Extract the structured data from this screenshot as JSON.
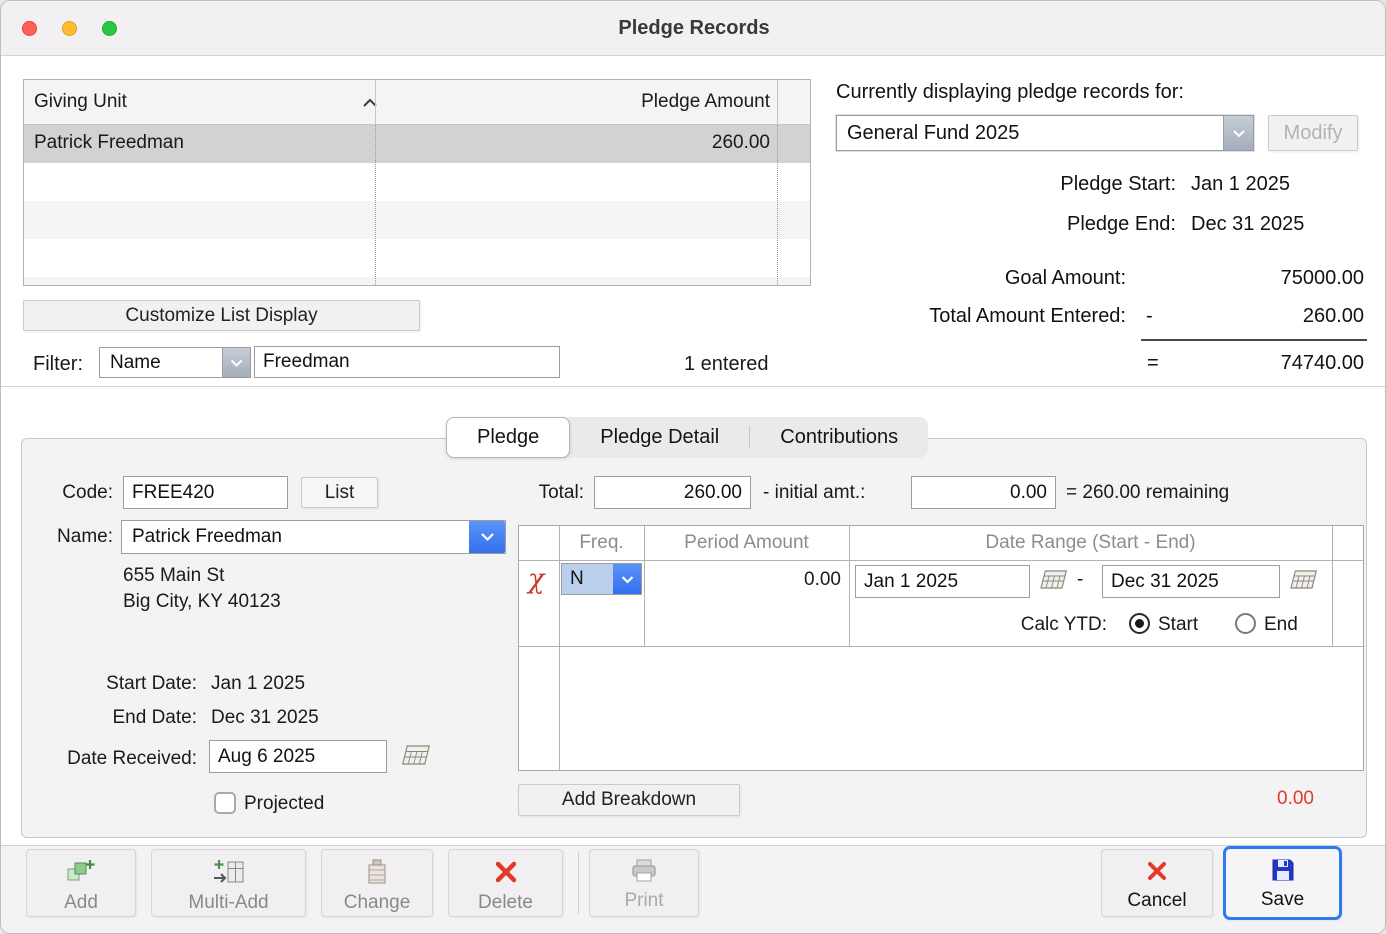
{
  "window": {
    "title": "Pledge Records"
  },
  "colors": {
    "accent_blue": "#3f7df6",
    "focus_ring_blue": "#2d7bee",
    "alert_red": "#e23a2a",
    "selected_row_gray": "#d3d1d2",
    "freq_highlight_blue": "#b9cfec"
  },
  "icons": {
    "sort_ascending": "chevron-up",
    "dropdown": "chevron-down",
    "delete_row_flag": "χ",
    "date_picker": "calendar",
    "add": "green-plus-squares",
    "multi_add": "grid-arrow-plus",
    "change": "card-file",
    "delete": "red-x",
    "print": "printer",
    "cancel": "red-x",
    "save": "floppy-disk"
  },
  "giving_list": {
    "col_giving_unit": "Giving Unit",
    "col_pledge_amount": "Pledge Amount",
    "rows": [
      {
        "name": "Patrick Freedman",
        "amount": "260.00"
      }
    ],
    "customize_button": "Customize List Display",
    "filter_label": "Filter:",
    "filter_field": "Name",
    "filter_value": "Freedman",
    "entered_count": "1 entered"
  },
  "fund_panel": {
    "heading": "Currently displaying pledge records for:",
    "fund_name": "General Fund 2025",
    "modify_button": "Modify",
    "pledge_start_label": "Pledge Start:",
    "pledge_start_value": "Jan 1 2025",
    "pledge_end_label": "Pledge End:",
    "pledge_end_value": "Dec 31 2025",
    "goal_label": "Goal Amount:",
    "goal_value": "75000.00",
    "entered_label": "Total Amount Entered:",
    "minus_sign": "-",
    "entered_value": "260.00",
    "equals_sign": "=",
    "remaining_value": "74740.00"
  },
  "detail": {
    "tabs": [
      {
        "label": "Pledge"
      },
      {
        "label": "Pledge Detail"
      },
      {
        "label": "Contributions"
      }
    ],
    "code_label": "Code:",
    "code_value": "FREE420",
    "list_button": "List",
    "name_label": "Name:",
    "name_value": "Patrick Freedman",
    "address_line1": "655 Main St",
    "address_line2": "Big City, KY 40123",
    "start_date_label": "Start Date:",
    "start_date_value": "Jan 1 2025",
    "end_date_label": "End Date:",
    "end_date_value": "Dec 31 2025",
    "date_received_label": "Date Received:",
    "date_received_value": "Aug 6 2025",
    "projected_label": "Projected",
    "total_label": "Total:",
    "total_value": "260.00",
    "initial_label": "- initial amt.:",
    "initial_value": "0.00",
    "remaining_text": "= 260.00 remaining",
    "breakdown": {
      "col_freq": "Freq.",
      "col_period_amount": "Period Amount",
      "col_date_range": "Date Range (Start - End)",
      "row_flag": "χ",
      "row_freq": "N",
      "row_amount": "0.00",
      "row_start": "Jan 1 2025",
      "row_dash": "-",
      "row_end": "Dec 31 2025",
      "calc_ytd_label": "Calc YTD:",
      "calc_start_label": "Start",
      "calc_end_label": "End",
      "add_button": "Add Breakdown",
      "total_value": "0.00"
    }
  },
  "toolbar": {
    "add": "Add",
    "multi_add": "Multi-Add",
    "change": "Change",
    "delete": "Delete",
    "print": "Print",
    "cancel": "Cancel",
    "save": "Save"
  }
}
